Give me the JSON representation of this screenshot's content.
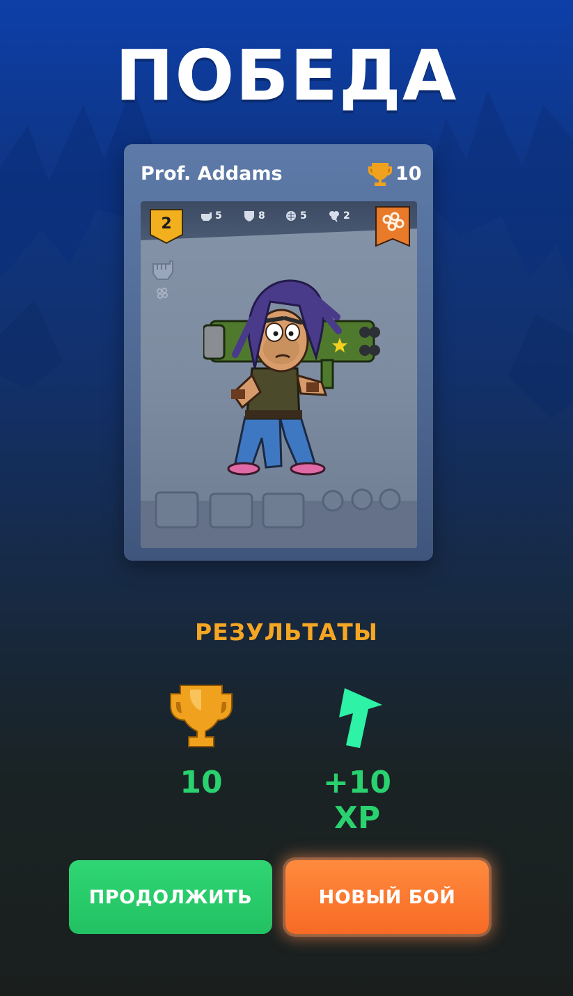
{
  "title": "ПОБЕДА",
  "card": {
    "name": "Prof. Addams",
    "trophies": "10",
    "level": "2",
    "stats": [
      {
        "icon": "fist-icon",
        "value": "5"
      },
      {
        "icon": "shield-icon",
        "value": "8"
      },
      {
        "icon": "brain-icon",
        "value": "5"
      },
      {
        "icon": "clover-icon",
        "value": "2"
      }
    ],
    "class_icon": "brass-knuckles-icon"
  },
  "results": {
    "title": "РЕЗУЛЬТАТЫ",
    "trophies": "10",
    "xp": "+10 XP"
  },
  "buttons": {
    "continue": "ПРОДОЛЖИТЬ",
    "new_battle": "НОВЫЙ БОЙ"
  },
  "colors": {
    "accent_orange": "#f5a623",
    "green": "#2ad16f",
    "button_green": "#2fd673",
    "button_orange": "#f76a25",
    "card_frame": "#5d7aa8"
  }
}
